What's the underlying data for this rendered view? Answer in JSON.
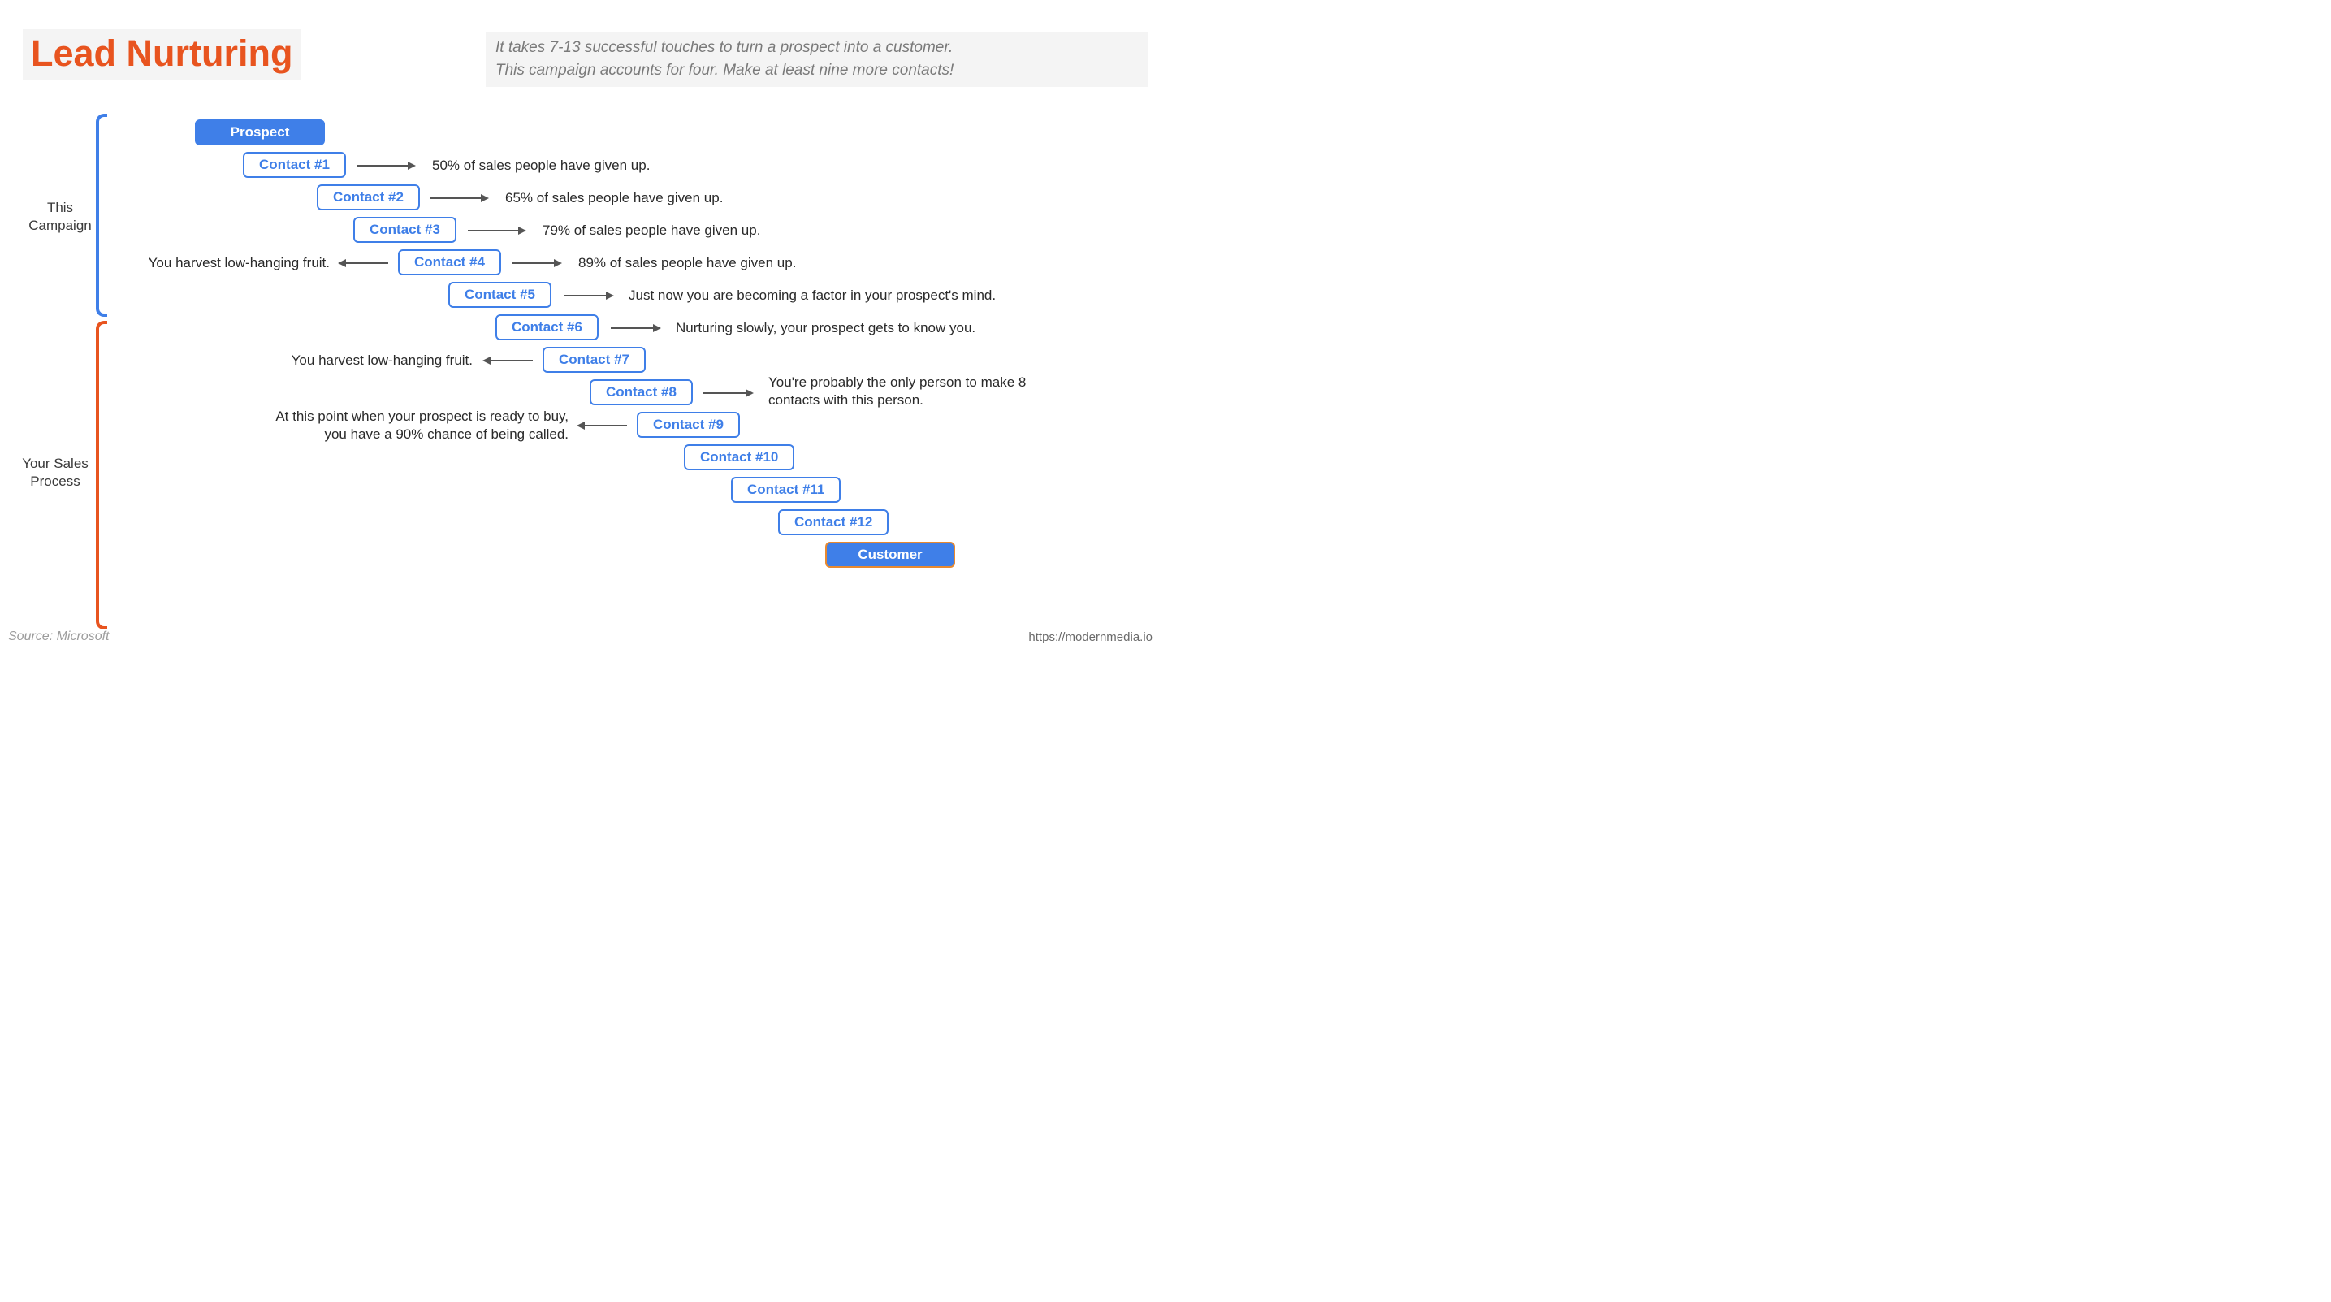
{
  "title": "Lead Nurturing",
  "subtitle_line1": "It takes 7-13 successful touches to turn a prospect into a customer.",
  "subtitle_line2": "This campaign accounts for four. Make at least nine more contacts!",
  "source": "Source: Microsoft",
  "url": "https://modernmedia.io",
  "bracket1_l1": "This",
  "bracket1_l2": "Campaign",
  "bracket2_l1": "Your Sales",
  "bracket2_l2": "Process",
  "steps": {
    "prospect": "Prospect",
    "c1": "Contact #1",
    "c2": "Contact #2",
    "c3": "Contact #3",
    "c4": "Contact #4",
    "c5": "Contact #5",
    "c6": "Contact #6",
    "c7": "Contact #7",
    "c8": "Contact #8",
    "c9": "Contact #9",
    "c10": "Contact #10",
    "c11": "Contact #11",
    "c12": "Contact #12",
    "customer": "Customer"
  },
  "notes": {
    "n1": "50% of sales people have given up.",
    "n2": "65% of sales people have given up.",
    "n3": "79% of sales people have given up.",
    "n4r": "89% of sales people have given up.",
    "n4l": "You harvest low-hanging fruit.",
    "n5": "Just now you are becoming a factor in your prospect's mind.",
    "n6": "Nurturing slowly, your prospect gets to know you.",
    "n7l": "You harvest low-hanging fruit.",
    "n8": "You're probably the only person to make 8 contacts with this person.",
    "n9l_a": "At this point when your prospect is ready to buy,",
    "n9l_b": "you have a 90% chance of being called."
  }
}
